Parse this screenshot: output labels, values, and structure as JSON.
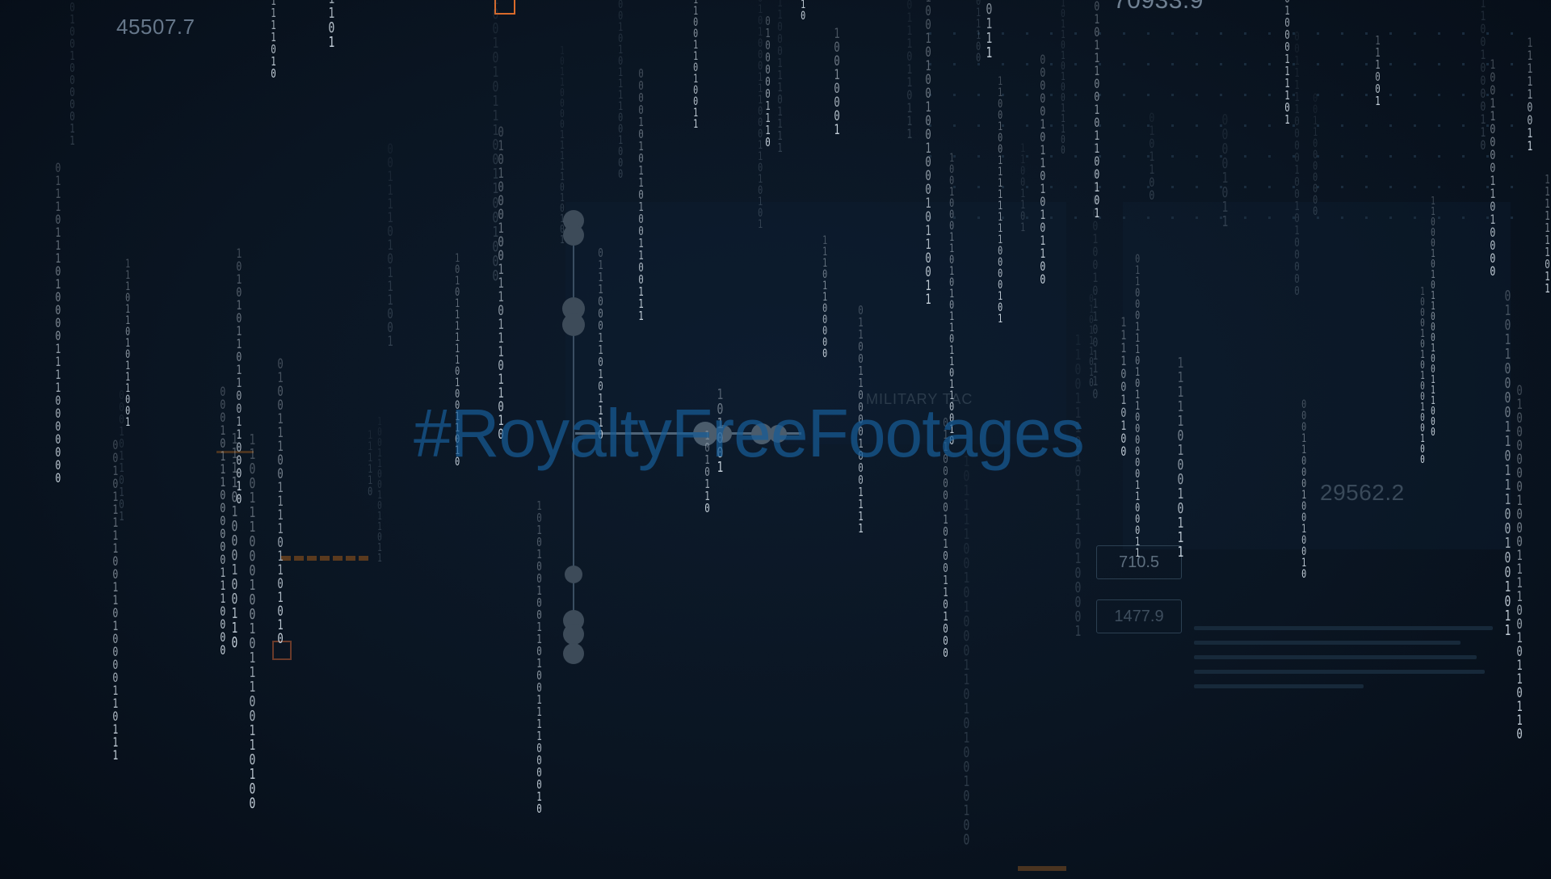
{
  "overlay": {
    "watermark": "#RoyaltyFreeFootages",
    "faint_label": "MILITARY TAC"
  },
  "readouts": {
    "top_left": "45507.7",
    "top_right": "70933.9",
    "right": "29562.2",
    "box_1": "710.5",
    "box_2": "1477.9"
  },
  "colors": {
    "background": "#0a1522",
    "rain": "#c3ced8",
    "rain_dim": "#5d6d7c",
    "accent_orange": "#d96a2a",
    "watermark": "#165c96"
  }
}
